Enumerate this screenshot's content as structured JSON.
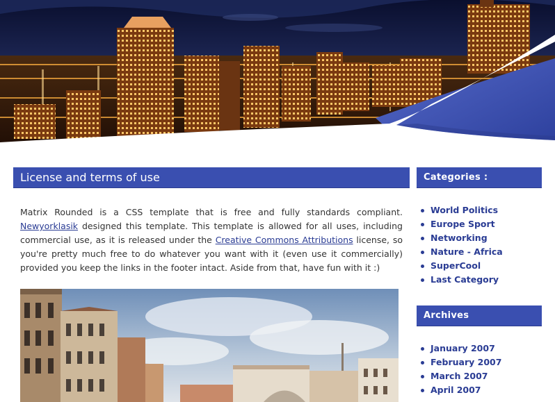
{
  "main": {
    "title": "License and terms of use",
    "intro": {
      "text1": "Matrix Rounded is a CSS template that is free and fully standards compliant. ",
      "link1": "Newyorklasik",
      "text2": " designed this template. This template is allowed for all uses, including commercial use, as it is released under the ",
      "link2": "Creative Commons Attributions",
      "text3": " license, so you're pretty much free to do whatever you want with it (even use it commercially) provided you keep the links in the footer intact. Aside from that, have fun with it :)"
    }
  },
  "sidebar": {
    "categories": {
      "title": "Categories :",
      "items": [
        "World Politics",
        "Europe Sport",
        "Networking",
        "Nature - Africa",
        "SuperCool",
        "Last Category"
      ]
    },
    "archives": {
      "title": "Archives",
      "items": [
        "January 2007",
        "February 2007",
        "March 2007",
        "April 2007"
      ]
    }
  },
  "colors": {
    "accent": "#3a4fb0",
    "link": "#2a3c94",
    "text": "#333333"
  }
}
